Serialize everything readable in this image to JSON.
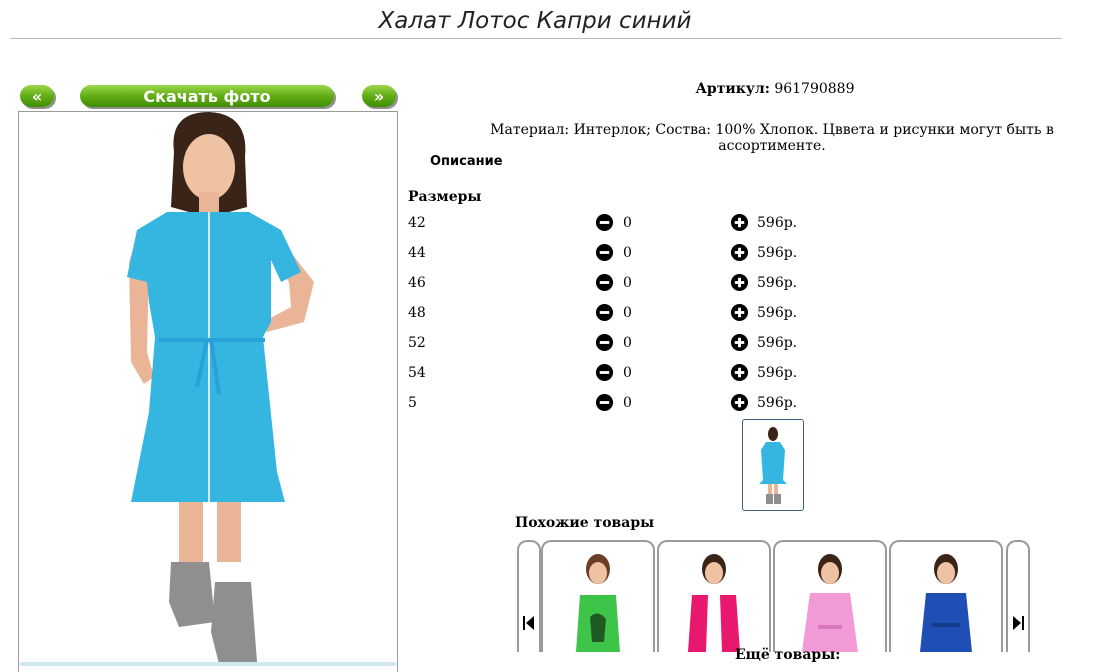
{
  "page": {
    "title": "Халат Лотос Капри синий"
  },
  "photo_controls": {
    "prev_label": "«",
    "download_label": "Скачать фото",
    "next_label": "»"
  },
  "product": {
    "article_label": "Артикул:",
    "article_value": "961790889",
    "material": "Материал: Интерлок; Соства: 100% Хлопок. Цввета и рисунки могут быть в ассортименте.",
    "description_heading": "Описание",
    "sizes_heading": "Размеры",
    "sizes": [
      {
        "size": "42",
        "qty": "0",
        "price": "596р."
      },
      {
        "size": "44",
        "qty": "0",
        "price": "596р."
      },
      {
        "size": "46",
        "qty": "0",
        "price": "596р."
      },
      {
        "size": "48",
        "qty": "0",
        "price": "596р."
      },
      {
        "size": "52",
        "qty": "0",
        "price": "596р."
      },
      {
        "size": "54",
        "qty": "0",
        "price": "596р."
      },
      {
        "size": "5",
        "qty": "0",
        "price": "596р."
      }
    ]
  },
  "similar": {
    "heading": "Похожие товары",
    "more_heading": "Ещё товары:",
    "items": [
      {
        "icon": "green-dress-photo-icon",
        "color": "#3fc44a"
      },
      {
        "icon": "pink-vest-photo-icon",
        "color": "#e8186e"
      },
      {
        "icon": "pink-robe-photo-icon",
        "color": "#f29ad6"
      },
      {
        "icon": "blue-robe-photo-icon",
        "color": "#1f4fb5"
      }
    ]
  },
  "colors": {
    "button_green": "#5fae14",
    "robe_blue": "#35b6e0",
    "thumb_border": "#3b5e7e"
  }
}
